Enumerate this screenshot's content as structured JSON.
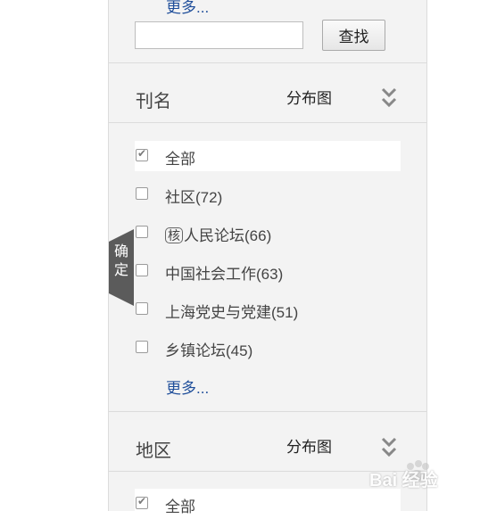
{
  "top": {
    "more_label": "更多...",
    "search_value": "",
    "search_button": "查找"
  },
  "journal": {
    "title": "刊名",
    "dist_label": "分布图",
    "items": [
      {
        "label": "全部",
        "checked": true
      },
      {
        "label": "社区(72)",
        "checked": false
      },
      {
        "label": "人民论坛(66)",
        "checked": false,
        "badge": "核"
      },
      {
        "label": "中国社会工作(63)",
        "checked": false
      },
      {
        "label": "上海党史与党建(51)",
        "checked": false
      },
      {
        "label": "乡镇论坛(45)",
        "checked": false
      }
    ],
    "more_label": "更多..."
  },
  "region": {
    "title": "地区",
    "dist_label": "分布图",
    "items": [
      {
        "label": "全部",
        "checked": true
      }
    ]
  },
  "confirm_tab": {
    "label": "确定"
  },
  "watermark": {
    "text": "Bai 经验"
  }
}
